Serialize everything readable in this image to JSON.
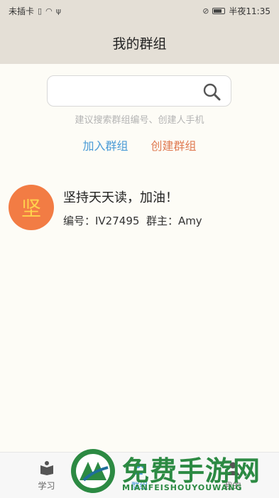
{
  "status_bar": {
    "carrier": "未插卡",
    "time": "半夜11:35"
  },
  "nav": {
    "title": "我的群组"
  },
  "search": {
    "placeholder": "",
    "hint": "建议搜索群组编号、创建人手机"
  },
  "actions": {
    "join": "加入群组",
    "create": "创建群组"
  },
  "groups": [
    {
      "avatar_char": "坚",
      "name": "坚持天天读，加油！",
      "meta": "编号：IV27495  群主：Amy"
    }
  ],
  "tabs": [
    {
      "label": "学习",
      "icon": "book-icon"
    },
    {
      "label": "群组",
      "icon": "group-icon"
    },
    {
      "label": "我的",
      "icon": "user-icon"
    }
  ],
  "watermark": {
    "title": "免费手游网",
    "subtitle": "MIANFEISHOUYOUWANG"
  },
  "colors": {
    "header_bg": "#e4dfd6",
    "join_link": "#4a9bd6",
    "create_link": "#e07b53",
    "avatar_bg": "#f27c44",
    "avatar_text": "#ffd24d",
    "watermark": "#2c8a43"
  }
}
